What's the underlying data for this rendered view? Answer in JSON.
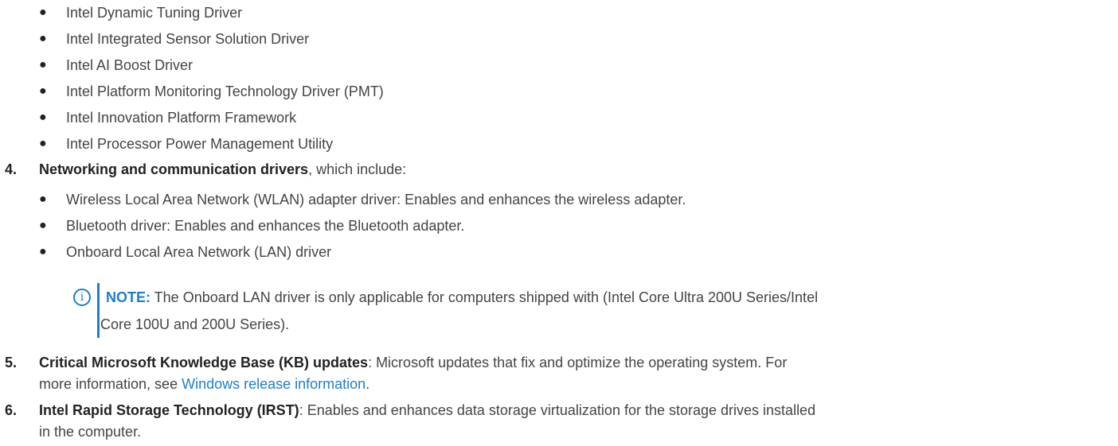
{
  "sub_bullets_top": [
    "Intel Dynamic Tuning Driver",
    "Intel Integrated Sensor Solution Driver",
    "Intel AI Boost Driver",
    "Intel Platform Monitoring Technology Driver (PMT)",
    "Intel Innovation Platform Framework",
    "Intel Processor Power Management Utility"
  ],
  "item4": {
    "number": "4.",
    "title": "Networking and communication drivers",
    "suffix": ", which include:",
    "bullets": [
      "Wireless Local Area Network (WLAN) adapter driver: Enables and enhances the wireless adapter.",
      "Bluetooth driver: Enables and enhances the Bluetooth adapter.",
      "Onboard Local Area Network (LAN) driver"
    ],
    "note": {
      "icon": "info-icon",
      "label": "NOTE:",
      "line1": " The Onboard LAN driver is only applicable for computers shipped with (Intel Core Ultra 200U Series/Intel",
      "line2": "Core 100U and 200U Series)."
    }
  },
  "item5": {
    "number": "5.",
    "title": "Critical Microsoft Knowledge Base (KB) updates",
    "text1": ": Microsoft updates that fix and optimize the operating system. For",
    "text2_prefix": "more information, see ",
    "link": "Windows release information",
    "text2_suffix": "."
  },
  "item6": {
    "number": "6.",
    "title": "Intel Rapid Storage Technology (IRST)",
    "text1": ": Enables and enhances data storage virtualization for the storage drives installed",
    "text2": "in the computer."
  },
  "colors": {
    "text": "#444444",
    "heading": "#222222",
    "accent": "#1e7fc6"
  }
}
